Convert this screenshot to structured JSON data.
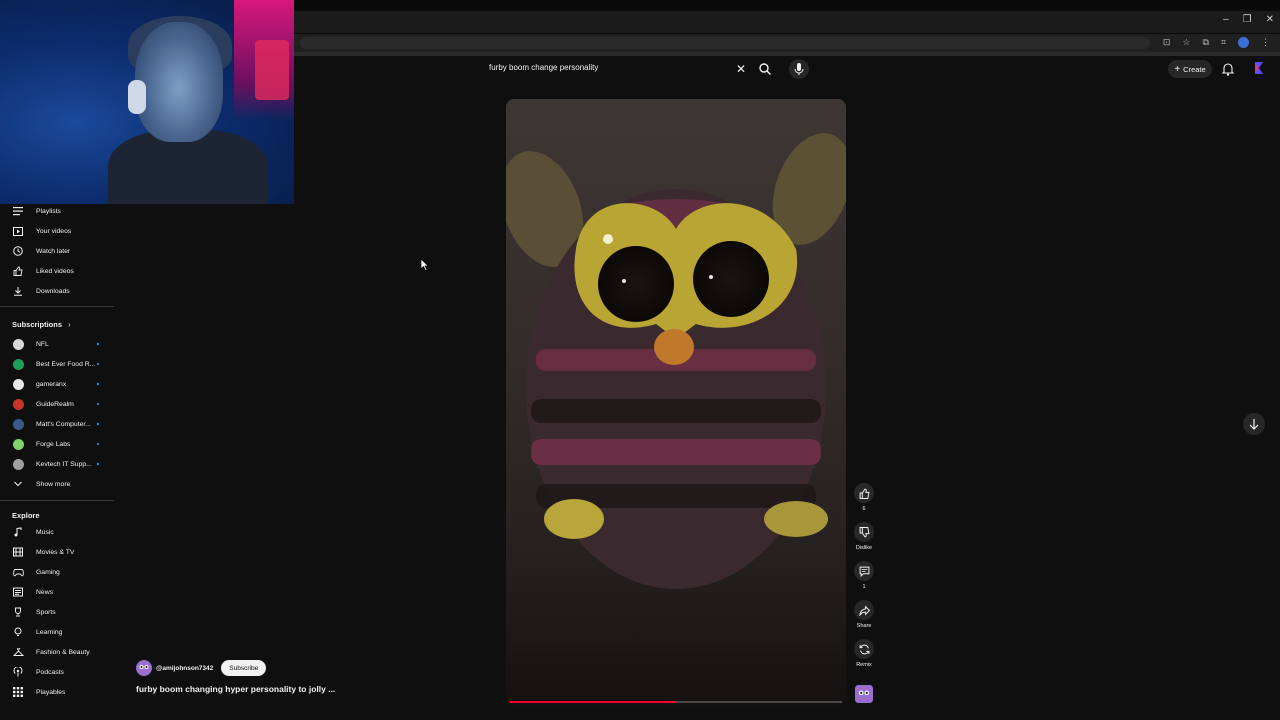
{
  "search": {
    "query": "furby boom change personality"
  },
  "header": {
    "create_label": "Create"
  },
  "sidebar": {
    "you_items": [
      {
        "label": "Playlists",
        "icon": "playlist-icon"
      },
      {
        "label": "Your videos",
        "icon": "your-videos-icon"
      },
      {
        "label": "Watch later",
        "icon": "clock-icon"
      },
      {
        "label": "Liked videos",
        "icon": "thumbs-up-icon"
      },
      {
        "label": "Downloads",
        "icon": "download-icon"
      }
    ],
    "subscriptions_title": "Subscriptions",
    "subscriptions": [
      {
        "label": "NFL",
        "color": "#d9d9d9"
      },
      {
        "label": "Best Ever Food R...",
        "color": "#1d9e5a"
      },
      {
        "label": "gameranx",
        "color": "#e8e8e8"
      },
      {
        "label": "GuideRealm",
        "color": "#c8352a"
      },
      {
        "label": "Matt's Computer...",
        "color": "#3a5a8a"
      },
      {
        "label": "Forge Labs",
        "color": "#7fd36a"
      },
      {
        "label": "Kevtech IT Supp...",
        "color": "#a0a0a0"
      }
    ],
    "show_more_label": "Show more",
    "explore_title": "Explore",
    "explore_items": [
      {
        "label": "Music",
        "icon": "music-icon"
      },
      {
        "label": "Movies & TV",
        "icon": "film-icon"
      },
      {
        "label": "Gaming",
        "icon": "gamepad-icon"
      },
      {
        "label": "News",
        "icon": "news-icon"
      },
      {
        "label": "Sports",
        "icon": "trophy-icon"
      },
      {
        "label": "Learning",
        "icon": "lightbulb-icon"
      },
      {
        "label": "Fashion & Beauty",
        "icon": "hanger-icon"
      },
      {
        "label": "Podcasts",
        "icon": "podcast-icon"
      },
      {
        "label": "Playables",
        "icon": "grid-icon"
      }
    ]
  },
  "short": {
    "channel": "@amijohnson7342",
    "subscribe_label": "Subscribe",
    "title": "furby boom changing hyper personality to jolly ...",
    "progress": 0.5
  },
  "actions": {
    "like_count": "6",
    "dislike_label": "Dislike",
    "comment_count": "1",
    "share_label": "Share",
    "remix_label": "Remix"
  },
  "colors": {
    "accent_red": "#ff0033",
    "background": "#0f0f0f",
    "chip": "#272727"
  }
}
